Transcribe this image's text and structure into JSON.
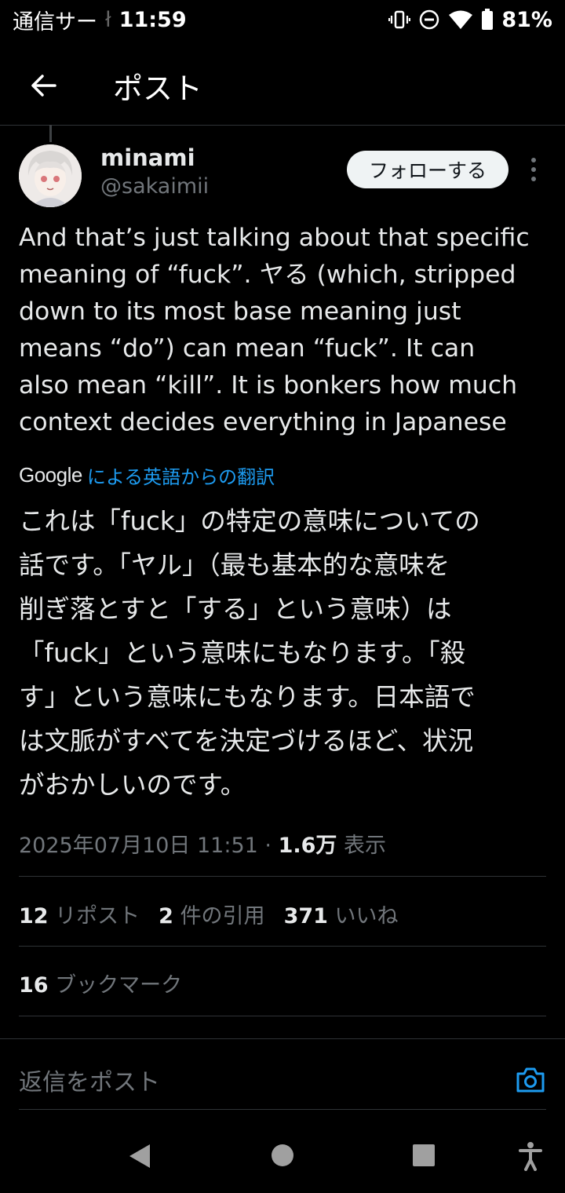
{
  "status_bar": {
    "carrier": "通信サー",
    "carrier_fade": "ł",
    "time": "11:59",
    "battery_percent": "81%",
    "icons": [
      "vibrate-icon",
      "do-not-disturb-icon",
      "wifi-icon",
      "battery-icon"
    ]
  },
  "header": {
    "title": "ポスト"
  },
  "post": {
    "author_name": "minami",
    "author_handle": "@sakaimii",
    "follow_label": "フォローする",
    "text_en": "And that’s just talking about that specific\nmeaning of “fuck”. ヤる (which, stripped\ndown to its most base meaning just\nmeans “do”) can mean “fuck”. It can\nalso mean “kill”. It is bonkers how much\ncontext decides everything in Japanese",
    "translate_provider": "Google",
    "translate_label": "による英語からの翻訳",
    "text_ja": "これは「fuck」の特定の意味についての\n話です。「ヤル」（最も基本的な意味を\n削ぎ落とすと「する」という意味）は\n「fuck」という意味にもなります。「殺\nす」という意味にもなります。日本語で\nは文脈がすべてを決定づけるほど、状況\nがおかしいのです。",
    "timestamp": "2025年07月10日 11:51",
    "separator": " · ",
    "views_count": "1.6万",
    "views_label": " 表示"
  },
  "stats": {
    "reposts_count": "12",
    "reposts_label": "リポスト",
    "quotes_count": "2",
    "quotes_label": "件の引用",
    "likes_count": "371",
    "likes_label": "いいね",
    "bookmarks_count": "16",
    "bookmarks_label": "ブックマーク"
  },
  "reply": {
    "placeholder": "返信をポスト"
  },
  "colors": {
    "background": "#000000",
    "text": "#e7e9ea",
    "muted": "#71767b",
    "link": "#1d9bf0",
    "divider": "#2f3336"
  }
}
